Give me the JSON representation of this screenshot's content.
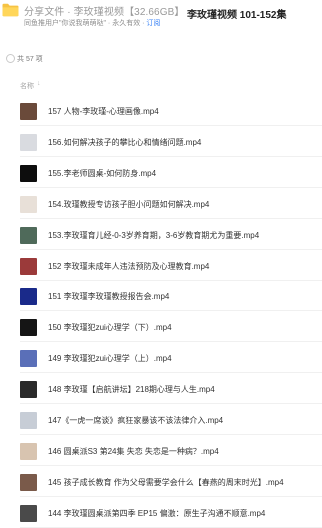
{
  "header": {
    "breadcrumb": "分享文件 · 李玫瑾视频【32.66GB】",
    "title": "李玫瑾视频 101-152集",
    "subline_prefix": "同鱼推用户\"你说我萌萌哒\" · 永久有效 · ",
    "subline_link": "订阅"
  },
  "list_meta": {
    "count": "共 57 项",
    "name_header": "名称",
    "sort_icon": "↓"
  },
  "files": [
    {
      "name": "157 人物-李玫瑾-心理画像.mp4",
      "thumb_color": "#6a4a3a"
    },
    {
      "name": "156.如何解决孩子的攀比心和情绪问题.mp4",
      "thumb_color": "#d9dbe0"
    },
    {
      "name": "155.李老师圆桌-如何防身.mp4",
      "thumb_color": "#0d0d0d"
    },
    {
      "name": "154.玫瑾教授专访孩子胆小问题如何解决.mp4",
      "thumb_color": "#e8e0d8"
    },
    {
      "name": "153.李玫瑾育儿经-0-3岁养育期，3-6岁教育期尤为重要.mp4",
      "thumb_color": "#4f6a5a"
    },
    {
      "name": "152 李玫瑾未成年人违法预防及心理教育.mp4",
      "thumb_color": "#9b3a3a"
    },
    {
      "name": "151 李玫瑾李玫瑾教授报告会.mp4",
      "thumb_color": "#1a2a8a"
    },
    {
      "name": "150 李玫瑾犯zui心理学（下）.mp4",
      "thumb_color": "#151515"
    },
    {
      "name": "149 李玫瑾犯zui心理学（上）.mp4",
      "thumb_color": "#5a6fb8"
    },
    {
      "name": "148 李玫瑾【启航讲坛】218期心理与人生.mp4",
      "thumb_color": "#2a2a2a"
    },
    {
      "name": "147《一虎一席谈》疯狂家暴该不该法律介入.mp4",
      "thumb_color": "#c7cdd6"
    },
    {
      "name": "146 圆桌派S3 第24集 失恋 失恋是一种病？.mp4",
      "thumb_color": "#d8c4b0"
    },
    {
      "name": "145 孩子成长教育 作为父母需要学会什么【春燕的周末时光】.mp4",
      "thumb_color": "#7a5a4a"
    },
    {
      "name": "144 李玫瑾圆桌派第四季 EP15 偏激：原生子沟通不顺意.mp4",
      "thumb_color": "#4a4a4a"
    }
  ]
}
